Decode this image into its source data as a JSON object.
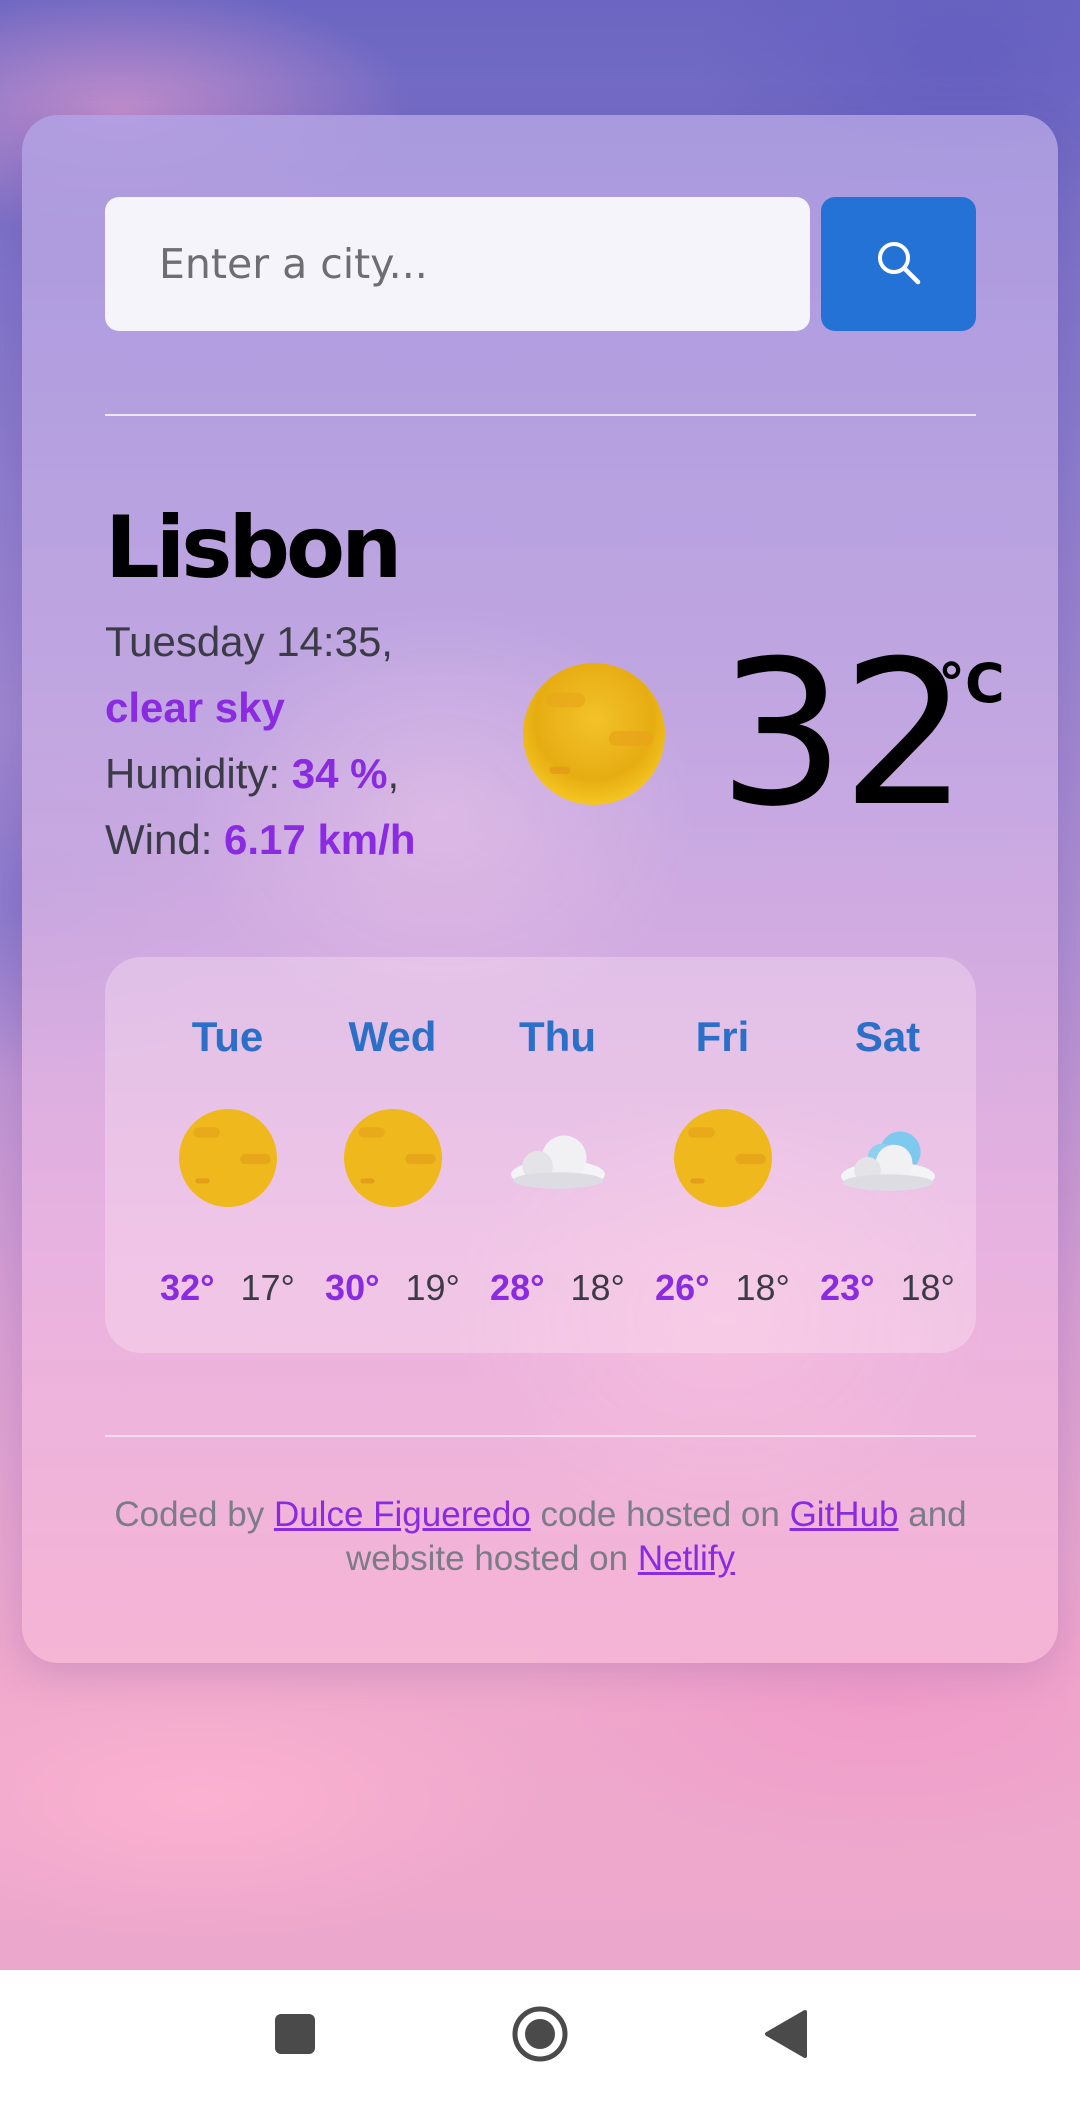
{
  "search": {
    "placeholder": "Enter a city...",
    "button_icon": "search-icon",
    "button_color": "#2472d6"
  },
  "current": {
    "city": "Lisbon",
    "datetime": "Tuesday 14:35,",
    "description": "clear sky",
    "humidity_label": "Humidity:",
    "humidity_value": "34 %",
    "humidity_suffix": ",",
    "wind_label": "Wind:",
    "wind_value": "6.17 km/h",
    "icon": "sun-icon",
    "temperature": "32",
    "unit": "°C"
  },
  "forecast": [
    {
      "day": "Tue",
      "icon": "sun-icon",
      "max": "32°",
      "min": "17°"
    },
    {
      "day": "Wed",
      "icon": "sun-icon",
      "max": "30°",
      "min": "19°"
    },
    {
      "day": "Thu",
      "icon": "cloud-icon",
      "max": "28°",
      "min": "18°"
    },
    {
      "day": "Fri",
      "icon": "sun-icon",
      "max": "26°",
      "min": "18°"
    },
    {
      "day": "Sat",
      "icon": "cloud-icon",
      "max": "23°",
      "min": "18°"
    }
  ],
  "footer": {
    "text1": "Coded by ",
    "link1": "Dulce Figueredo",
    "text2": " code hosted on ",
    "link2": "GitHub",
    "text3": " and website hosted on ",
    "link3": "Netlify"
  },
  "colors": {
    "accent_purple": "#8a2be2",
    "day_blue": "#2b6fc9"
  },
  "navbar": {
    "recents_icon": "square-icon",
    "home_icon": "circle-home-icon",
    "back_icon": "triangle-back-icon"
  }
}
